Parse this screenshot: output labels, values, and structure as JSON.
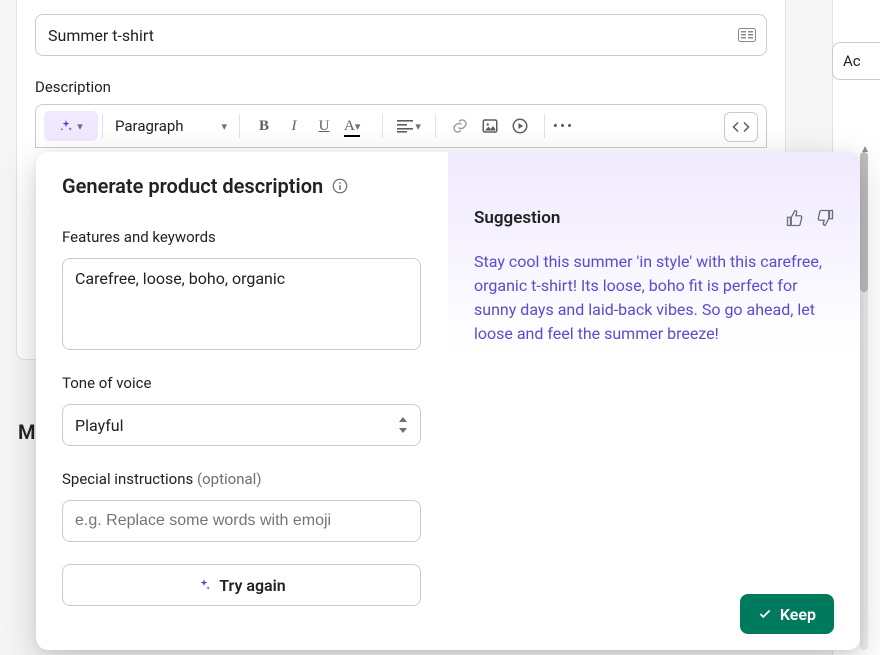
{
  "product": {
    "title": "Summer t-shirt",
    "description_label": "Description"
  },
  "toolbar": {
    "paragraph_label": "Paragraph"
  },
  "right_sidebar": {
    "button_label": "Ac"
  },
  "ai": {
    "title": "Generate product description",
    "features_label": "Features and keywords",
    "features_value": "Carefree, loose, boho, organic",
    "tone_label": "Tone of voice",
    "tone_value": "Playful",
    "special_label": "Special instructions",
    "special_optional": "(optional)",
    "special_placeholder": "e.g. Replace some words with emoji",
    "try_again_label": "Try again",
    "suggestion_label": "Suggestion",
    "suggestion_text": "Stay cool this summer 'in style' with this carefree, organic t-shirt! Its loose, boho fit is perfect for sunny days and laid-back vibes. So go ahead, let loose and feel the summer breeze!",
    "keep_label": "Keep"
  },
  "bg": {
    "letter": "M"
  }
}
